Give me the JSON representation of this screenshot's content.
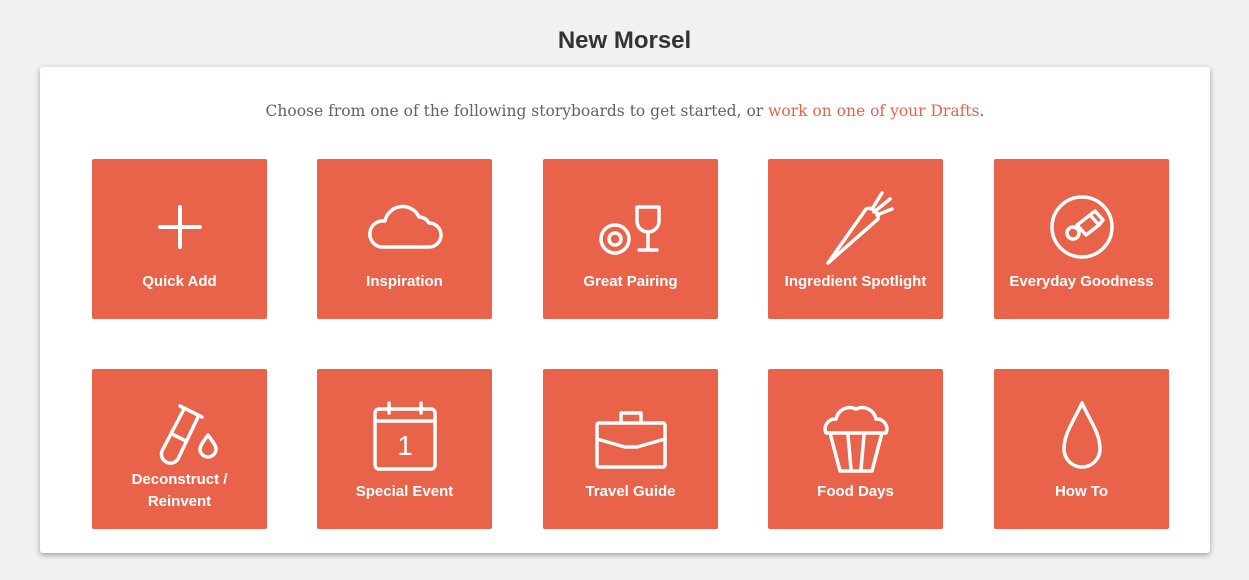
{
  "page": {
    "title": "New Morsel"
  },
  "intro": {
    "text_before": "Choose from one of the following storyboards to get started, or ",
    "drafts_link": "work on one of your Drafts",
    "text_after": "."
  },
  "colors": {
    "accent": "#e8634a",
    "background": "#f2f1ef",
    "card": "#ffffff",
    "title_text": "#333333",
    "body_text": "#5f6266"
  },
  "storyboards": [
    {
      "label": "Quick Add",
      "icon": "plus-icon"
    },
    {
      "label": "Inspiration",
      "icon": "cloud-icon"
    },
    {
      "label": "Great Pairing",
      "icon": "plate-and-glass-icon"
    },
    {
      "label": "Ingredient Spotlight",
      "icon": "carrot-icon"
    },
    {
      "label": "Everyday Goodness",
      "icon": "plate-with-food-icon"
    },
    {
      "label_line1": "Deconstruct /",
      "label_line2": "Reinvent",
      "icon": "test-tube-icon"
    },
    {
      "label": "Special Event",
      "icon": "calendar-icon",
      "calendar_day": "1"
    },
    {
      "label": "Travel Guide",
      "icon": "briefcase-icon"
    },
    {
      "label": "Food Days",
      "icon": "cupcake-icon"
    },
    {
      "label": "How To",
      "icon": "droplet-icon"
    }
  ]
}
